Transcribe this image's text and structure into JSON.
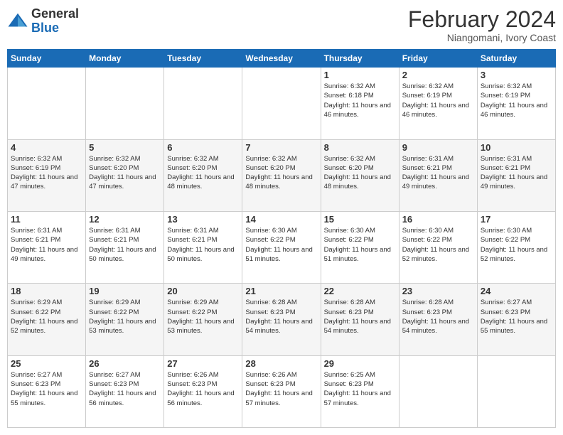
{
  "logo": {
    "general": "General",
    "blue": "Blue"
  },
  "title": "February 2024",
  "subtitle": "Niangomani, Ivory Coast",
  "days_of_week": [
    "Sunday",
    "Monday",
    "Tuesday",
    "Wednesday",
    "Thursday",
    "Friday",
    "Saturday"
  ],
  "weeks": [
    [
      {
        "day": "",
        "info": ""
      },
      {
        "day": "",
        "info": ""
      },
      {
        "day": "",
        "info": ""
      },
      {
        "day": "",
        "info": ""
      },
      {
        "day": "1",
        "info": "Sunrise: 6:32 AM\nSunset: 6:18 PM\nDaylight: 11 hours and 46 minutes."
      },
      {
        "day": "2",
        "info": "Sunrise: 6:32 AM\nSunset: 6:19 PM\nDaylight: 11 hours and 46 minutes."
      },
      {
        "day": "3",
        "info": "Sunrise: 6:32 AM\nSunset: 6:19 PM\nDaylight: 11 hours and 46 minutes."
      }
    ],
    [
      {
        "day": "4",
        "info": "Sunrise: 6:32 AM\nSunset: 6:19 PM\nDaylight: 11 hours and 47 minutes."
      },
      {
        "day": "5",
        "info": "Sunrise: 6:32 AM\nSunset: 6:20 PM\nDaylight: 11 hours and 47 minutes."
      },
      {
        "day": "6",
        "info": "Sunrise: 6:32 AM\nSunset: 6:20 PM\nDaylight: 11 hours and 48 minutes."
      },
      {
        "day": "7",
        "info": "Sunrise: 6:32 AM\nSunset: 6:20 PM\nDaylight: 11 hours and 48 minutes."
      },
      {
        "day": "8",
        "info": "Sunrise: 6:32 AM\nSunset: 6:20 PM\nDaylight: 11 hours and 48 minutes."
      },
      {
        "day": "9",
        "info": "Sunrise: 6:31 AM\nSunset: 6:21 PM\nDaylight: 11 hours and 49 minutes."
      },
      {
        "day": "10",
        "info": "Sunrise: 6:31 AM\nSunset: 6:21 PM\nDaylight: 11 hours and 49 minutes."
      }
    ],
    [
      {
        "day": "11",
        "info": "Sunrise: 6:31 AM\nSunset: 6:21 PM\nDaylight: 11 hours and 49 minutes."
      },
      {
        "day": "12",
        "info": "Sunrise: 6:31 AM\nSunset: 6:21 PM\nDaylight: 11 hours and 50 minutes."
      },
      {
        "day": "13",
        "info": "Sunrise: 6:31 AM\nSunset: 6:21 PM\nDaylight: 11 hours and 50 minutes."
      },
      {
        "day": "14",
        "info": "Sunrise: 6:30 AM\nSunset: 6:22 PM\nDaylight: 11 hours and 51 minutes."
      },
      {
        "day": "15",
        "info": "Sunrise: 6:30 AM\nSunset: 6:22 PM\nDaylight: 11 hours and 51 minutes."
      },
      {
        "day": "16",
        "info": "Sunrise: 6:30 AM\nSunset: 6:22 PM\nDaylight: 11 hours and 52 minutes."
      },
      {
        "day": "17",
        "info": "Sunrise: 6:30 AM\nSunset: 6:22 PM\nDaylight: 11 hours and 52 minutes."
      }
    ],
    [
      {
        "day": "18",
        "info": "Sunrise: 6:29 AM\nSunset: 6:22 PM\nDaylight: 11 hours and 52 minutes."
      },
      {
        "day": "19",
        "info": "Sunrise: 6:29 AM\nSunset: 6:22 PM\nDaylight: 11 hours and 53 minutes."
      },
      {
        "day": "20",
        "info": "Sunrise: 6:29 AM\nSunset: 6:22 PM\nDaylight: 11 hours and 53 minutes."
      },
      {
        "day": "21",
        "info": "Sunrise: 6:28 AM\nSunset: 6:23 PM\nDaylight: 11 hours and 54 minutes."
      },
      {
        "day": "22",
        "info": "Sunrise: 6:28 AM\nSunset: 6:23 PM\nDaylight: 11 hours and 54 minutes."
      },
      {
        "day": "23",
        "info": "Sunrise: 6:28 AM\nSunset: 6:23 PM\nDaylight: 11 hours and 54 minutes."
      },
      {
        "day": "24",
        "info": "Sunrise: 6:27 AM\nSunset: 6:23 PM\nDaylight: 11 hours and 55 minutes."
      }
    ],
    [
      {
        "day": "25",
        "info": "Sunrise: 6:27 AM\nSunset: 6:23 PM\nDaylight: 11 hours and 55 minutes."
      },
      {
        "day": "26",
        "info": "Sunrise: 6:27 AM\nSunset: 6:23 PM\nDaylight: 11 hours and 56 minutes."
      },
      {
        "day": "27",
        "info": "Sunrise: 6:26 AM\nSunset: 6:23 PM\nDaylight: 11 hours and 56 minutes."
      },
      {
        "day": "28",
        "info": "Sunrise: 6:26 AM\nSunset: 6:23 PM\nDaylight: 11 hours and 57 minutes."
      },
      {
        "day": "29",
        "info": "Sunrise: 6:25 AM\nSunset: 6:23 PM\nDaylight: 11 hours and 57 minutes."
      },
      {
        "day": "",
        "info": ""
      },
      {
        "day": "",
        "info": ""
      }
    ]
  ]
}
